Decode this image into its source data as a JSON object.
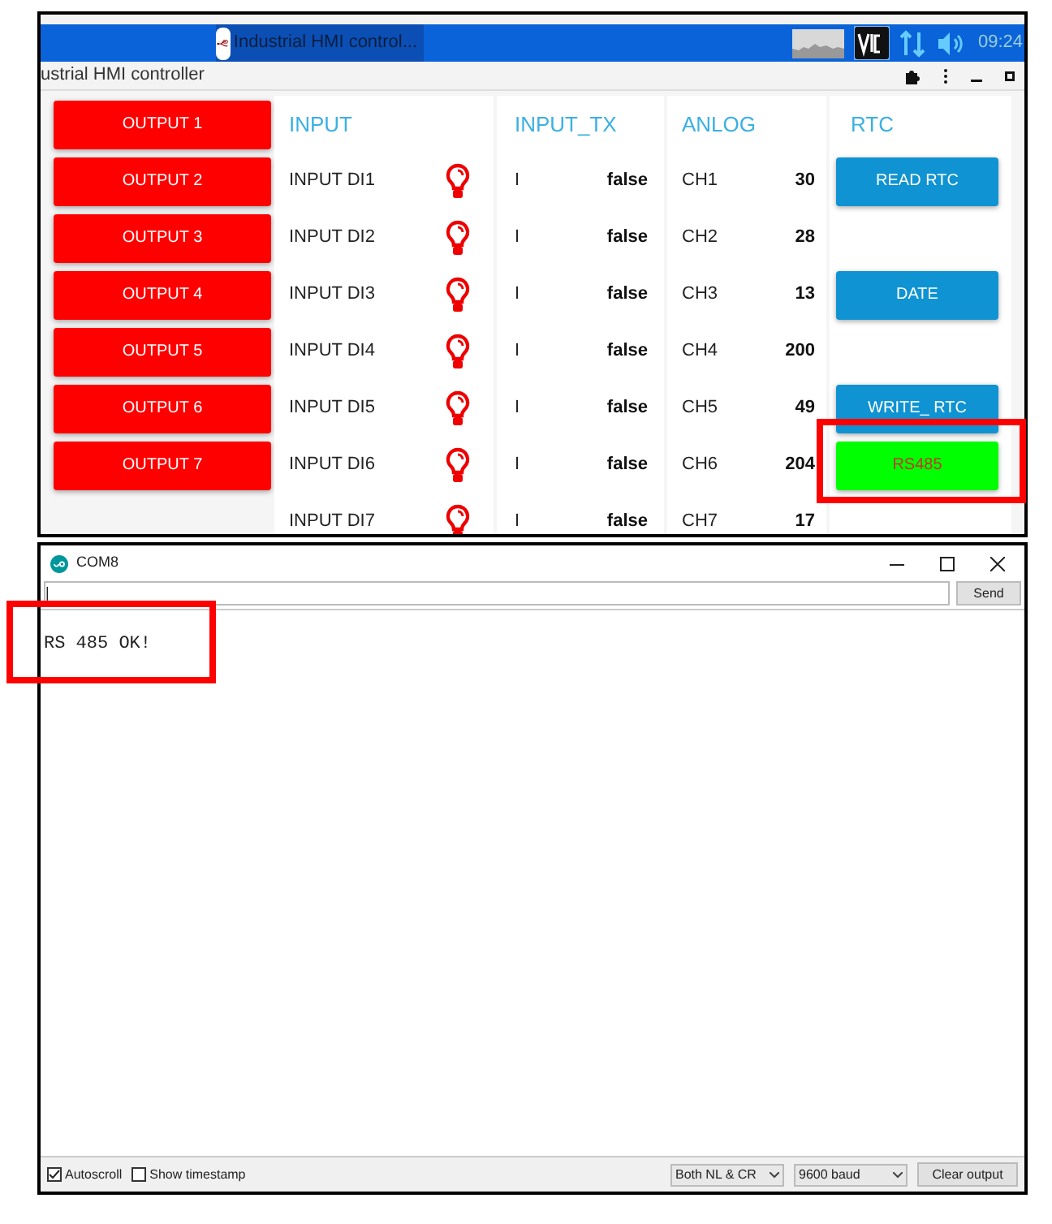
{
  "taskbar": {
    "app_title": "Industrial HMI control...",
    "clock": "09:24"
  },
  "window": {
    "title": "ustrial HMI controller"
  },
  "outputs": [
    "OUTPUT 1",
    "OUTPUT 2",
    "OUTPUT 3",
    "OUTPUT 4",
    "OUTPUT 5",
    "OUTPUT 6",
    "OUTPUT 7"
  ],
  "headers": [
    "INPUT",
    "INPUT_TX",
    "ANLOG",
    "RTC"
  ],
  "rows": [
    {
      "input": "INPUT DI1",
      "tx": "I",
      "tx_value": "false",
      "channel": "CH1",
      "channel_value": "30",
      "rtc": {
        "label": "READ RTC",
        "color": "#0f93d2"
      }
    },
    {
      "input": "INPUT DI2",
      "tx": "I",
      "tx_value": "false",
      "channel": "CH2",
      "channel_value": "28"
    },
    {
      "input": "INPUT DI3",
      "tx": "I",
      "tx_value": "false",
      "channel": "CH3",
      "channel_value": "13",
      "rtc": {
        "label": "DATE",
        "color": "#0f93d2"
      }
    },
    {
      "input": "INPUT DI4",
      "tx": "I",
      "tx_value": "false",
      "channel": "CH4",
      "channel_value": "200"
    },
    {
      "input": "INPUT DI5",
      "tx": "I",
      "tx_value": "false",
      "channel": "CH5",
      "channel_value": "49",
      "rtc": {
        "label": "WRITE_ RTC",
        "color": "#0f93d2"
      }
    },
    {
      "input": "INPUT DI6",
      "tx": "I",
      "tx_value": "false",
      "channel": "CH6",
      "channel_value": "204",
      "rtc": {
        "label": "RS485",
        "color": "#00ff00"
      }
    },
    {
      "input": "INPUT DI7",
      "tx": "I",
      "tx_value": "false",
      "channel": "CH7",
      "channel_value": "17"
    }
  ],
  "serial": {
    "title": "COM8",
    "input_value": "|",
    "send": "Send",
    "output": "RS 485 OK!",
    "options": [
      {
        "label": "Autoscroll",
        "checked": true
      },
      {
        "label": "Show timestamp",
        "checked": false
      }
    ],
    "line_ending": "Both NL & CR",
    "baud": "9600 baud",
    "clear": "Clear output"
  }
}
